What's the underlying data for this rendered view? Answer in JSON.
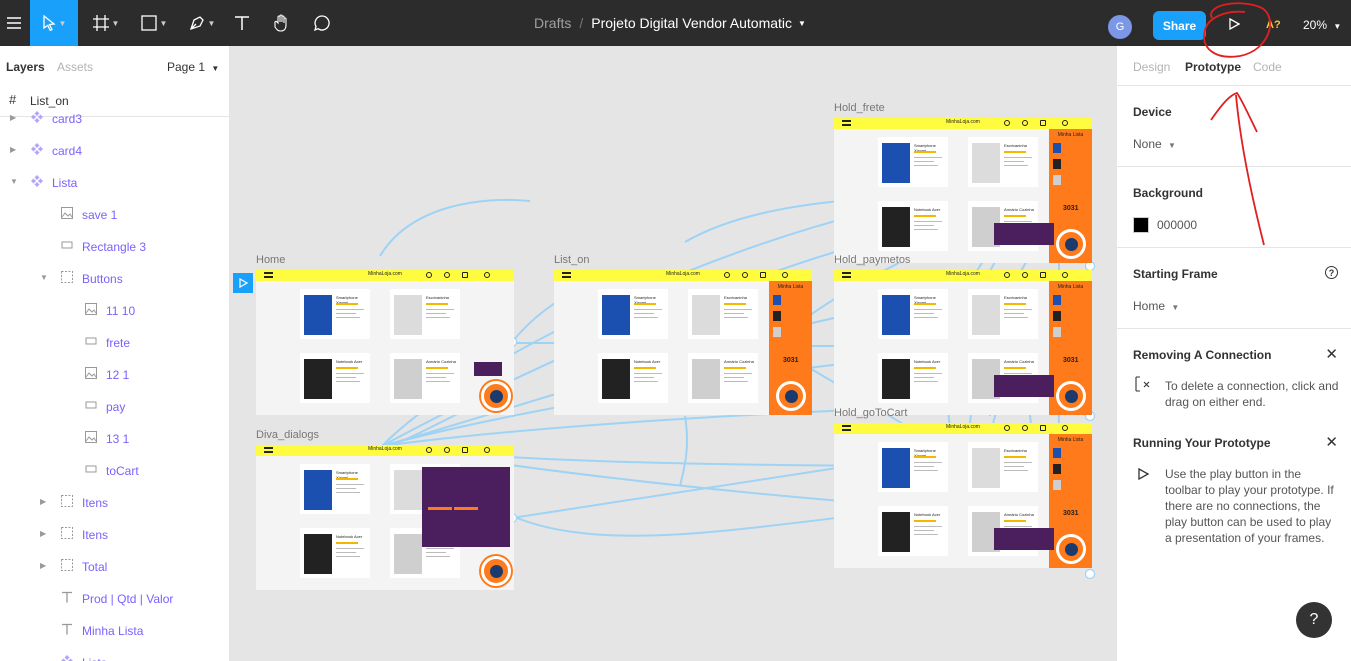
{
  "toolbar": {
    "file_breadcrumb": "Drafts",
    "separator": "/",
    "file_name": "Projeto Digital Vendor Automatic",
    "avatar_initial": "G",
    "share_label": "Share",
    "help_badge": "A?",
    "zoom": "20%"
  },
  "left_panel": {
    "tabs": [
      "Layers",
      "Assets"
    ],
    "page": "Page 1",
    "frame": "List_on",
    "layers": [
      {
        "label": "card3",
        "type": "component"
      },
      {
        "label": "card4",
        "type": "component"
      },
      {
        "label": "Lista",
        "type": "component"
      },
      {
        "label": "save 1",
        "type": "image"
      },
      {
        "label": "Rectangle 3",
        "type": "rectangle"
      },
      {
        "label": "Buttons",
        "type": "group"
      },
      {
        "label": "11 10",
        "type": "image"
      },
      {
        "label": "frete",
        "type": "rectangle"
      },
      {
        "label": "12 1",
        "type": "image"
      },
      {
        "label": "pay",
        "type": "rectangle"
      },
      {
        "label": "13 1",
        "type": "image"
      },
      {
        "label": "toCart",
        "type": "rectangle"
      },
      {
        "label": "Itens",
        "type": "group"
      },
      {
        "label": "Itens",
        "type": "group"
      },
      {
        "label": "Total",
        "type": "group"
      },
      {
        "label": "Prod | Qtd | Valor",
        "type": "text"
      },
      {
        "label": "Minha Lista",
        "type": "text"
      },
      {
        "label": "Lista",
        "type": "component"
      }
    ]
  },
  "right_panel": {
    "tabs": [
      "Design",
      "Prototype",
      "Code"
    ],
    "device_title": "Device",
    "device_value": "None",
    "background_title": "Background",
    "background_value": "000000",
    "background_color": "#000000",
    "starting_frame_title": "Starting Frame",
    "starting_frame_value": "Home",
    "removing_title": "Removing A Connection",
    "removing_text": "To delete a connection, click and drag on either end.",
    "running_title": "Running Your Prototype",
    "running_text": "Use the play button in the toolbar to play your prototype. If there are no connections, the play button can be used to play a presentation of your frames."
  },
  "canvas": {
    "site_name": "MinhaLoja.com",
    "frames": [
      "Home",
      "Diva_dialogs",
      "List_on",
      "Hold_frete",
      "Hold_paymetos",
      "Hold_goToCart"
    ],
    "products": [
      "Smartphone Xiaomi",
      "Escrivaninha",
      "Notebook Acer",
      "Armário Cozinha"
    ],
    "list_title": "Minha Lista",
    "total_value": "3031"
  },
  "colors": {
    "accent": "#18a0fb",
    "toolbar": "#2c2c2c",
    "frame_header": "#fffc3f",
    "list_orange": "#ff7a1a",
    "dialog_purple": "#4b1f5e",
    "connector": "#9fd3f5",
    "annotation": "#e02020"
  }
}
